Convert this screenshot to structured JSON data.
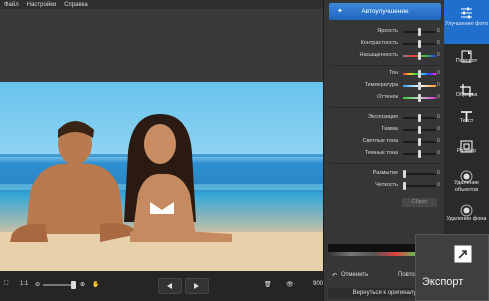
{
  "menu": [
    "Файл",
    "Настройки",
    "Справка"
  ],
  "panel": {
    "auto_button": "Автоулучшение",
    "sliders_group1": [
      {
        "label": "Яркость",
        "value": "0"
      },
      {
        "label": "Контрастность",
        "value": "0"
      },
      {
        "label": "Насыщенность",
        "value": "0"
      }
    ],
    "sliders_group2": [
      {
        "label": "Тон",
        "value": "0"
      },
      {
        "label": "Температура",
        "value": "0"
      },
      {
        "label": "Оттенок",
        "value": "0"
      }
    ],
    "sliders_group3": [
      {
        "label": "Экспозиция",
        "value": "0"
      },
      {
        "label": "Гамма",
        "value": "0"
      },
      {
        "label": "Светлые тона",
        "value": "0"
      },
      {
        "label": "Темные тона",
        "value": "0"
      }
    ],
    "sliders_group4": [
      {
        "label": "Размытие",
        "value": "0"
      },
      {
        "label": "Четкость",
        "value": "0"
      }
    ],
    "reset": "Сброс",
    "undo": "Отменить",
    "redo": "Повто",
    "revert": "Вернуться к оригиналу"
  },
  "tools": [
    {
      "label": "Улучшение фото",
      "icon": "sliders-icon"
    },
    {
      "label": "Поворот",
      "icon": "rotate-icon"
    },
    {
      "label": "Обрезка",
      "icon": "crop-icon"
    },
    {
      "label": "Текст",
      "icon": "text-icon"
    },
    {
      "label": "Размер",
      "icon": "resize-icon"
    },
    {
      "label": "Удаление объектов",
      "icon": "remove-object-icon"
    },
    {
      "label": "Удаление фона",
      "icon": "remove-background-icon"
    }
  ],
  "export": {
    "label": "Экспорт"
  },
  "bottom": {
    "ratio": "1:1",
    "zoom": "900"
  }
}
